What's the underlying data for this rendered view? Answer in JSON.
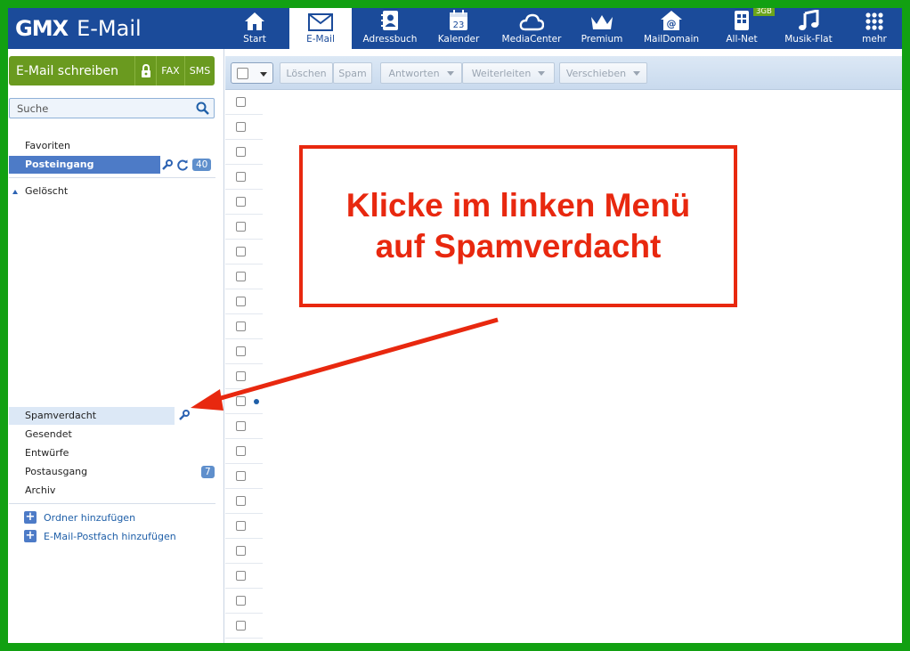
{
  "header": {
    "brand": "GMX",
    "product": "E-Mail",
    "nav": [
      {
        "label": "Start",
        "icon": "home-icon"
      },
      {
        "label": "E-Mail",
        "icon": "envelope-icon",
        "active": true
      },
      {
        "label": "Adressbuch",
        "icon": "address-book-icon"
      },
      {
        "label": "Kalender",
        "icon": "calendar-icon",
        "day": "23"
      },
      {
        "label": "MediaCenter",
        "icon": "cloud-icon"
      },
      {
        "label": "Premium",
        "icon": "crown-icon"
      },
      {
        "label": "MailDomain",
        "icon": "maildomain-house-icon"
      },
      {
        "label": "All-Net",
        "icon": "phone-icon",
        "badge": "3GB"
      },
      {
        "label": "Musik-Flat",
        "icon": "music-note-icon"
      },
      {
        "label": "mehr",
        "icon": "grid-dots-icon"
      }
    ]
  },
  "sidebar": {
    "compose_label": "E-Mail schreiben",
    "fax_label": "FAX",
    "sms_label": "SMS",
    "search_placeholder": "Suche",
    "folders_top": [
      {
        "label": "Favoriten"
      },
      {
        "label": "Posteingang",
        "count": "40",
        "selected": true
      }
    ],
    "trash_label": "Gelöscht",
    "folders_bottom": [
      {
        "label": "Spamverdacht",
        "hover": true
      },
      {
        "label": "Gesendet"
      },
      {
        "label": "Entwürfe"
      },
      {
        "label": "Postausgang",
        "count": "7"
      },
      {
        "label": "Archiv"
      }
    ],
    "add_folder_label": "Ordner hinzufügen",
    "add_mailbox_label": "E-Mail-Postfach hinzufügen"
  },
  "toolbar": {
    "delete_label": "Löschen",
    "spam_label": "Spam",
    "reply_label": "Antworten",
    "forward_label": "Weiterleiten",
    "move_label": "Verschieben"
  },
  "annotation": {
    "line1": "Klicke im linken Menü",
    "line2": "auf Spamverdacht"
  },
  "colors": {
    "header_bg": "#1b4b9a",
    "compose_green": "#6a9a1f",
    "selected_folder": "#4d7bc7",
    "annotation_red": "#e8280f",
    "frame_green": "#12a012"
  }
}
